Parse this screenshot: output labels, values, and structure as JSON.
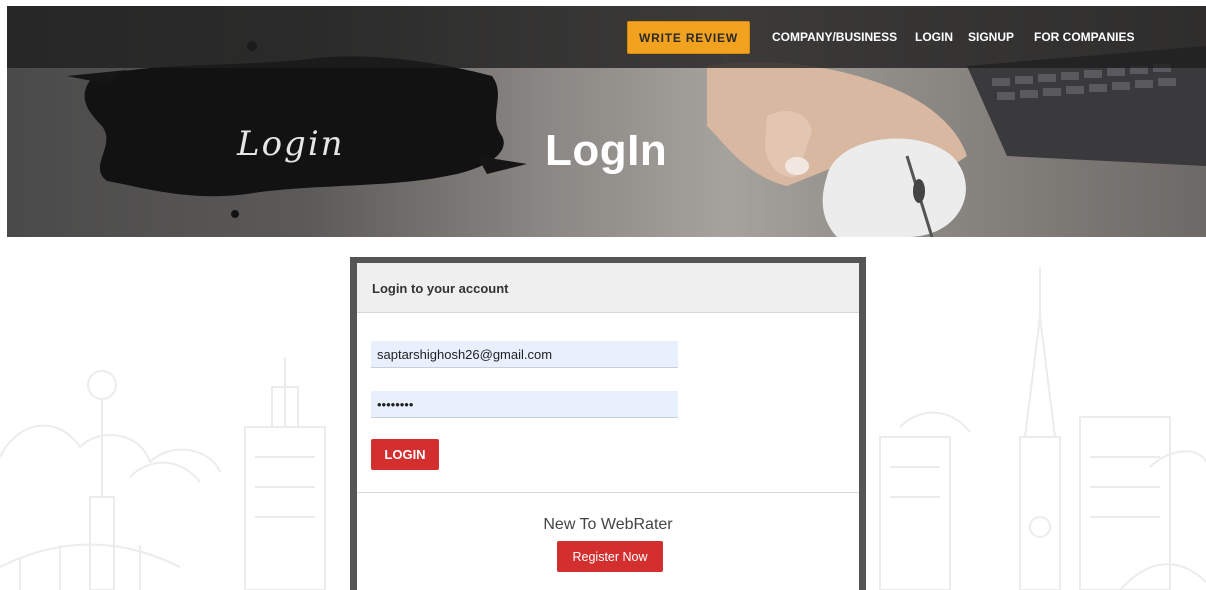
{
  "nav": {
    "write_review": "WRITE REVIEW",
    "links": [
      "COMPANY/BUSINESS",
      "LOGIN",
      "SIGNUP",
      "FOR COMPANIES"
    ]
  },
  "hero": {
    "brush_text": "Login",
    "title": "LogIn"
  },
  "login_card": {
    "header": "Login to your account",
    "email_value": "saptarshighosh26@gmail.com",
    "password_value": "password",
    "login_button": "LOGIN",
    "new_to": "New To WebRater",
    "register_button": "Register Now"
  },
  "colors": {
    "accent_orange": "#f2a21f",
    "button_red": "#d32f2f",
    "card_border": "#555555"
  }
}
